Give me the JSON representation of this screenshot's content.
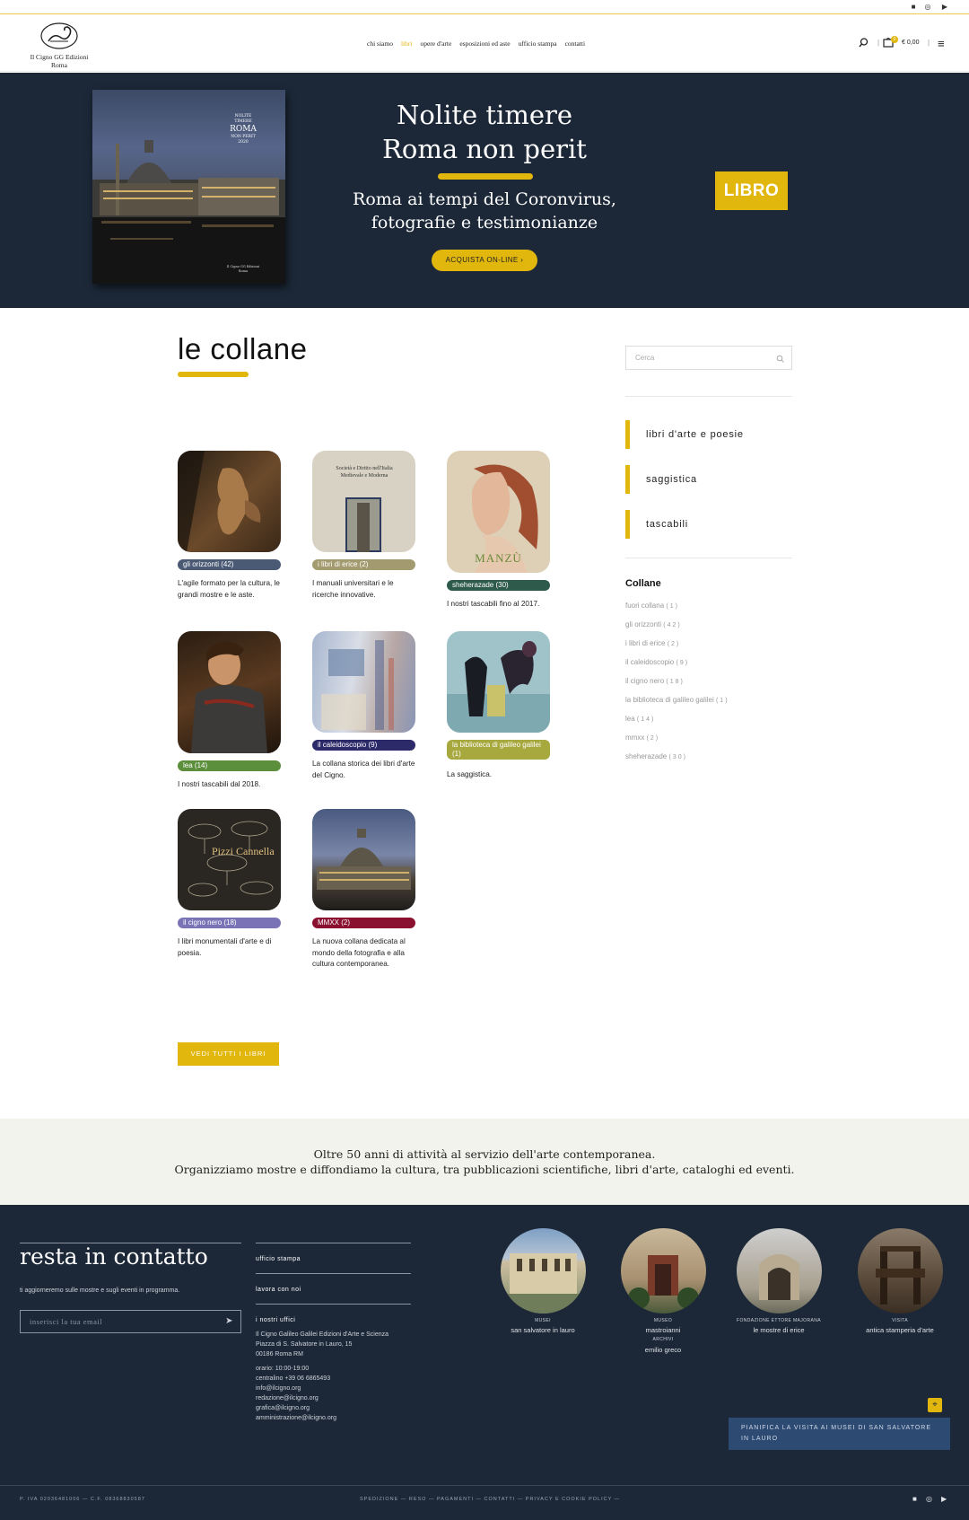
{
  "brand": {
    "name_line1": "Il Cigno GG Edizioni",
    "name_line2": "Roma"
  },
  "nav": [
    "chi siamo",
    "libri",
    "opere d'arte",
    "esposizioni ed aste",
    "ufficio stampa",
    "contatti"
  ],
  "nav_active": "libri",
  "cart": {
    "count": "0",
    "total": "€ 0,00"
  },
  "hero": {
    "title_line1": "Nolite timere",
    "title_line2": "Roma non perit",
    "subtitle_line1": "Roma ai tempi del Coronvirus,",
    "subtitle_line2": "fotografie e testimonianze",
    "buy_label": "ACQUISTA ON-LINE",
    "badge_label": "LIBRO",
    "book_cover": {
      "line1": "NOLITE",
      "line2": "TIMERE",
      "line3": "ROMA",
      "line4": "NON PERIT",
      "year": "2020",
      "publisher": "Il Cigno GG Edizioni",
      "city": "Roma"
    }
  },
  "main": {
    "title": "le collane",
    "view_all_label": "VEDI TUTTI I LIBRI"
  },
  "collections": [
    {
      "tag": "gli orizzonti (42)",
      "desc": "L'agile formato per la cultura, le grandi mostre e le aste.",
      "color": "#4a5a74"
    },
    {
      "tag": "i libri di erice (2)",
      "desc": "I manuali universitari e le ricerche innovative.",
      "color": "#a39b6f",
      "cover_text": "Società e Diritto nell'Italia Medievale e Moderna"
    },
    {
      "tag": "sheherazade (30)",
      "desc": "I nostri tascabili fino al 2017.",
      "color": "#2e5a4c",
      "cover_text": "MANZÙ"
    },
    {
      "tag": "lea (14)",
      "desc": "I nostri tascabili dal 2018.",
      "color": "#5c8f3c"
    },
    {
      "tag": "il caleidoscopio (9)",
      "desc": "La collana storica dei libri d'arte del Cigno.",
      "color": "#2d2a6a"
    },
    {
      "tag": "la biblioteca di galileo galilei (1)",
      "desc": "La saggistica.",
      "color": "#a7a83d"
    },
    {
      "tag": "il cigno nero (18)",
      "desc": "I libri monumentali d'arte e di poesia.",
      "color": "#7a73b5",
      "cover_text": "Pizzi Cannella"
    },
    {
      "tag": "MMXX (2)",
      "desc": "La nuova collana dedicata al mondo della fotografia e alla cultura contemporanea.",
      "color": "#8a1230"
    }
  ],
  "sidebar": {
    "search_placeholder": "Cerca",
    "categories": [
      "libri d'arte e poesie",
      "saggistica",
      "tascabili"
    ],
    "collane_title": "Collane",
    "collane": [
      {
        "name": "fuori collana",
        "count": "(1)"
      },
      {
        "name": "gli orizzonti",
        "count": "(42)"
      },
      {
        "name": "i libri di erice",
        "count": "(2)"
      },
      {
        "name": "il caleidoscopio",
        "count": "(9)"
      },
      {
        "name": "il cigno nero",
        "count": "(18)"
      },
      {
        "name": "la biblioteca di galileo galilei",
        "count": "(1)"
      },
      {
        "name": "lea",
        "count": "(14)"
      },
      {
        "name": "mmxx",
        "count": "(2)"
      },
      {
        "name": "sheherazade",
        "count": "(30)"
      }
    ]
  },
  "strip": {
    "line1": "Oltre 50 anni di attività al servizio dell'arte contemporanea.",
    "line2": "Organizziamo mostre e diffondiamo la cultura, tra pubblicazioni scientifiche, libri d'arte, cataloghi ed eventi."
  },
  "footer": {
    "title": "resta in contatto",
    "note": "ti aggiorneremo sulle mostre e sugli eventi in programma.",
    "email_placeholder": "inserisci la tua email",
    "links": [
      "ufficio stampa",
      "lavora con noi",
      "i nostri uffici"
    ],
    "address": [
      "Il Cigno Galileo Galilei Edizioni d'Arte e Scienza",
      "Piazza di S. Salvatore in Lauro, 15",
      "00186 Roma RM"
    ],
    "contacts": [
      "orario: 10:00-19:00",
      "centralino +39 06 6865493",
      "info@ilcigno.org",
      "redazione@ilcigno.org",
      "grafica@ilcigno.org",
      "amministrazione@ilcigno.org"
    ],
    "museums": [
      {
        "kind": "MUSEI",
        "name": "san salvatore in lauro"
      },
      {
        "kind": "MUSEO",
        "name": "mastroianni",
        "kind2": "ARCHIVI",
        "name2": "emilio greco"
      },
      {
        "kind": "FONDAZIONE ETTORE MAJORANA",
        "name": "le mostre di erice"
      },
      {
        "kind": "VISITA",
        "name": "antica stamperia d'arte"
      }
    ],
    "plan_label": "PIANIFICA LA VISITA AI MUSEI DI SAN SALVATORE IN LAURO",
    "vat": "P. IVA 02036481006 — C.F. 08368830587",
    "bottom_links": "SPEDIZIONE — RESO — PAGAMENTI — CONTATTI — PRIVACY E COOKIE POLICY —"
  },
  "colors": {
    "accent": "#e1b70e",
    "navy": "#1c2838",
    "plan_blue": "#2d4a72"
  }
}
